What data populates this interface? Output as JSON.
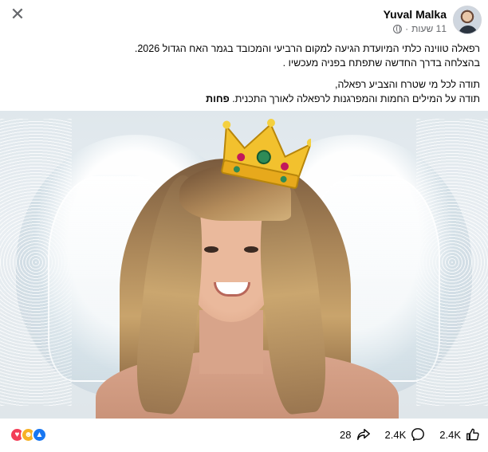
{
  "post": {
    "author": "Yuval Malka",
    "time": "11 שעות",
    "lines_paragraph_1": [
      "רפאלה טווינה  כלתי המיועדת הגיעה למקום הרביעי והמכובד בגמר האח הגדול 2026.",
      "בהצלחה בדרך החדשה שתפתח בפניה מעכשיו ."
    ],
    "lines_paragraph_2": [
      "תודה לכל מי שטרח והצביע רפאלה,",
      "תודה על המילים החמות והמפרגנות לרפאלה לאורך התכנית."
    ],
    "see_more": "פחות"
  },
  "footer": {
    "shares": "28",
    "comments": "2.4K",
    "likes": "2.4K"
  },
  "colors": {
    "love": "#f33e58",
    "haha": "#f7b125",
    "like": "#1877f2",
    "meta_gray": "#65676b"
  },
  "icons": [
    "close-icon",
    "globe-icon",
    "share-icon",
    "comment-icon",
    "like-icon",
    "love-reaction-icon",
    "haha-reaction-icon",
    "like-reaction-icon",
    "crown-icon"
  ]
}
